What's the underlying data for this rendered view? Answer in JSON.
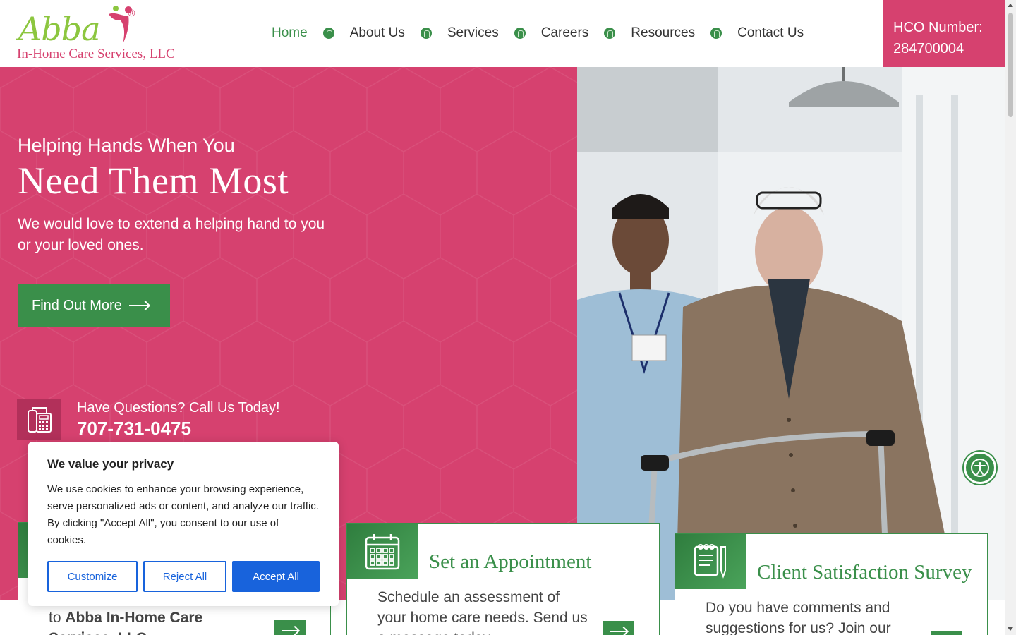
{
  "header": {
    "logo_script": "Abba",
    "logo_registered": "®",
    "logo_subtitle": "In-Home Care Services, LLC",
    "nav": [
      {
        "label": "Home",
        "active": true
      },
      {
        "label": "About Us",
        "active": false
      },
      {
        "label": "Services",
        "active": false
      },
      {
        "label": "Careers",
        "active": false
      },
      {
        "label": "Resources",
        "active": false
      },
      {
        "label": "Contact Us",
        "active": false
      }
    ],
    "hco_label": "HCO Number:",
    "hco_number": "284700004"
  },
  "hero": {
    "subtitle": "Helping Hands When You",
    "title": "Need Them Most",
    "text": "We would love to extend a helping hand to you or your loved ones.",
    "cta_label": "Find Out More",
    "phone_question": "Have Questions? Call Us Today!",
    "phone_number": "707-731-0475"
  },
  "cards": [
    {
      "title": "",
      "text_prefix": "to ",
      "text_bold": "Abba In-Home Care Services, LLC"
    },
    {
      "title": "Set an Appointment",
      "text": "Schedule an assessment of your home care needs. Send us a message today."
    },
    {
      "title": "Client Satisfaction Survey",
      "text": "Do you have comments and suggestions for us? Join our survey."
    }
  ],
  "cookie": {
    "title": "We value your privacy",
    "text": "We use cookies to enhance your browsing experience, serve personalized ads or content, and analyze our traffic. By clicking \"Accept All\", you consent to our use of cookies.",
    "customize": "Customize",
    "reject": "Reject All",
    "accept": "Accept All"
  },
  "icons": {
    "nav_separator": "leaf-icon",
    "phone": "telephone-icon",
    "appointment": "calendar-icon",
    "survey": "clipboard-pen-icon",
    "accessibility": "accessibility-icon",
    "cta": "arrow-right-icon"
  },
  "colors": {
    "brand_pink": "#d6416f",
    "brand_green": "#3a8f4a",
    "logo_green": "#8cc63f",
    "cookie_blue": "#1863dc"
  }
}
